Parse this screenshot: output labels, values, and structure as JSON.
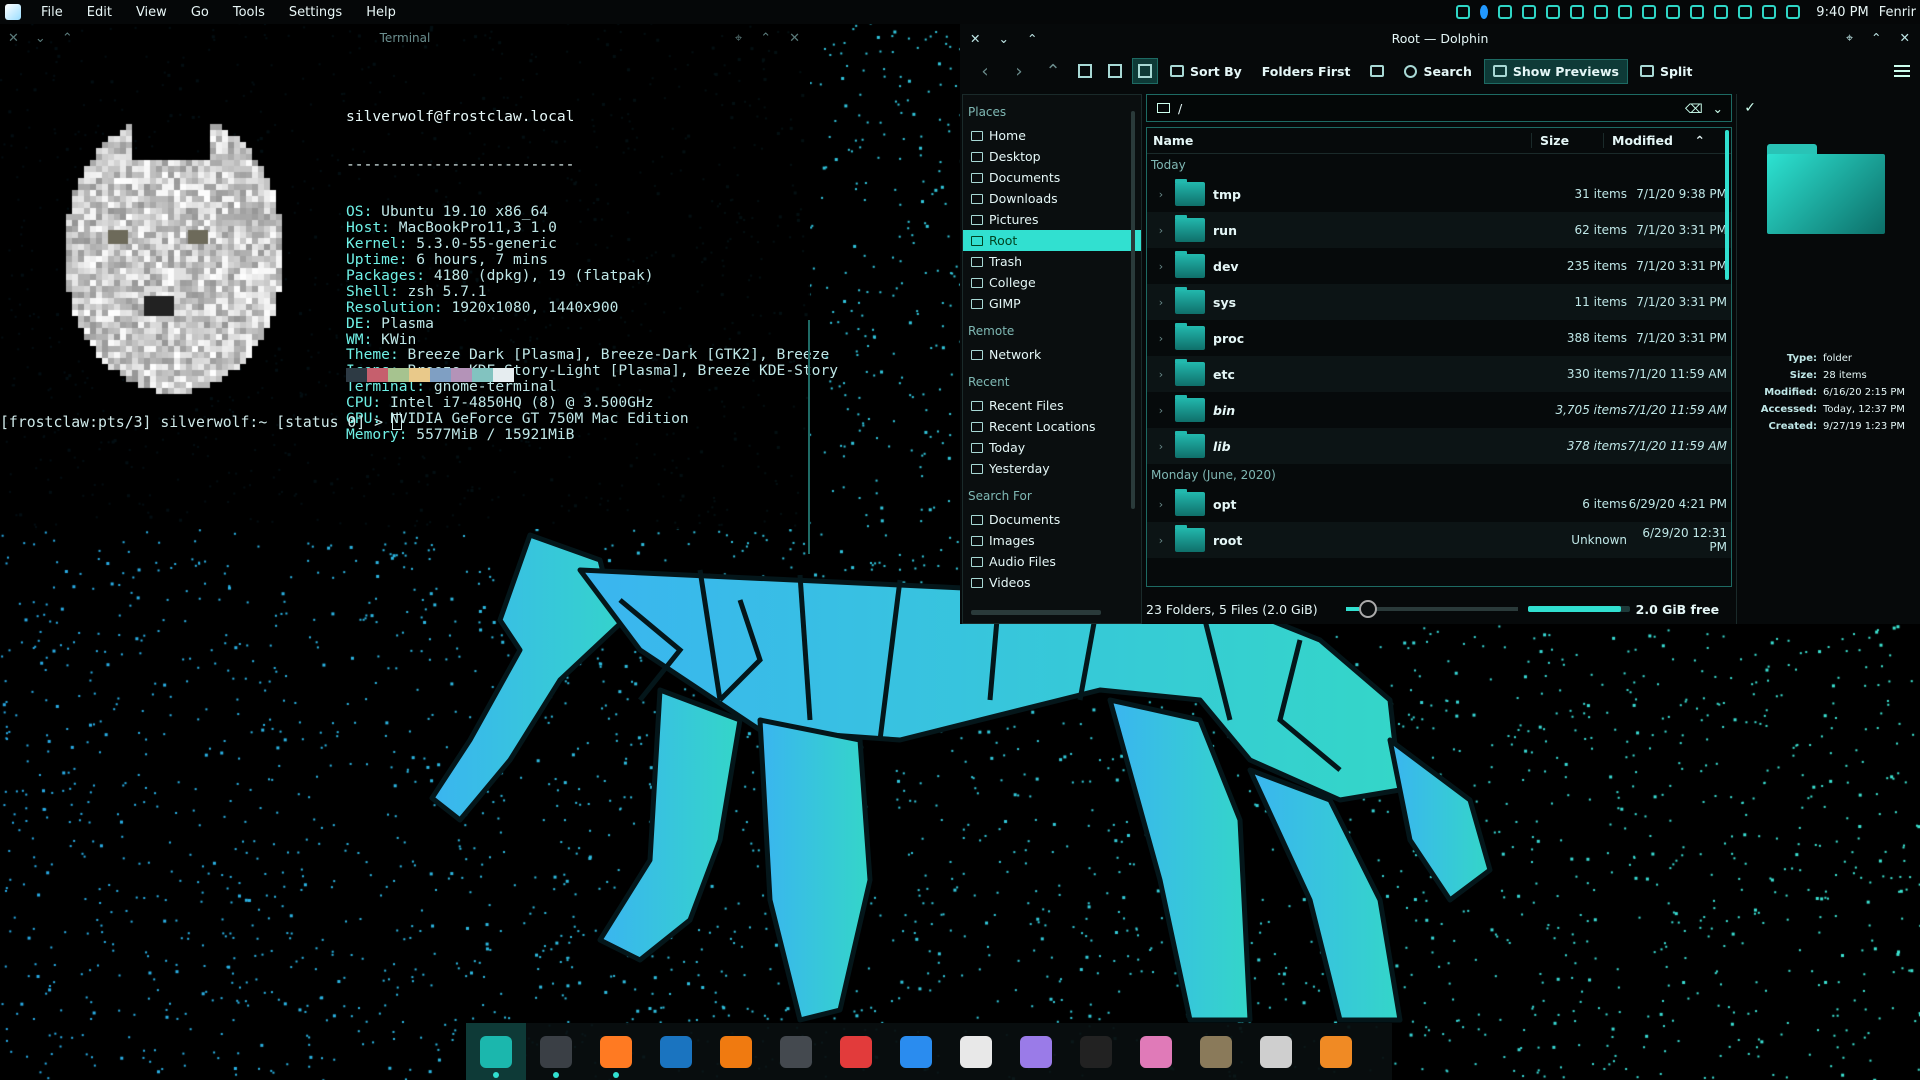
{
  "topbar": {
    "menu": [
      "File",
      "Edit",
      "View",
      "Go",
      "Tools",
      "Settings",
      "Help"
    ],
    "clock": "9:40 PM",
    "user": "Fenrir"
  },
  "terminal": {
    "title": "Terminal",
    "header": "silverwolf@frostclaw.local",
    "separator": "--------------------------",
    "lines": [
      {
        "k": "OS",
        "v": "Ubuntu 19.10 x86_64"
      },
      {
        "k": "Host",
        "v": "MacBookPro11,3 1.0"
      },
      {
        "k": "Kernel",
        "v": "5.3.0-55-generic"
      },
      {
        "k": "Uptime",
        "v": "6 hours, 7 mins"
      },
      {
        "k": "Packages",
        "v": "4180 (dpkg), 19 (flatpak)"
      },
      {
        "k": "Shell",
        "v": "zsh 5.7.1"
      },
      {
        "k": "Resolution",
        "v": "1920x1080, 1440x900"
      },
      {
        "k": "DE",
        "v": "Plasma"
      },
      {
        "k": "WM",
        "v": "KWin"
      },
      {
        "k": "Theme",
        "v": "Breeze Dark [Plasma], Breeze-Dark [GTK2], Breeze"
      },
      {
        "k": "Icons",
        "v": "Breeze KDE-Story-Light [Plasma], Breeze KDE-Story"
      },
      {
        "k": "Terminal",
        "v": "gnome-terminal"
      },
      {
        "k": "CPU",
        "v": "Intel i7-4850HQ (8) @ 3.500GHz"
      },
      {
        "k": "GPU",
        "v": "NVIDIA GeForce GT 750M Mac Edition"
      },
      {
        "k": "Memory",
        "v": "5577MiB / 15921MiB"
      }
    ],
    "swatches": [
      "#2d3a44",
      "#c65f6d",
      "#a6c38f",
      "#e9c98a",
      "#7f9fc3",
      "#b493b8",
      "#82c3c0",
      "#e6edf0"
    ],
    "prompt": "[frostclaw:pts/3] silverwolf:~ [status 0] > "
  },
  "dolphin": {
    "title": "Root — Dolphin",
    "toolbar": {
      "sort_by": "Sort By",
      "folders_first": "Folders First",
      "search": "Search",
      "show_previews": "Show Previews",
      "split": "Split"
    },
    "places": {
      "sections": [
        {
          "title": "Places",
          "items": [
            "Home",
            "Desktop",
            "Documents",
            "Downloads",
            "Pictures",
            "Root",
            "Trash",
            "College",
            "GIMP"
          ]
        },
        {
          "title": "Remote",
          "items": [
            "Network"
          ]
        },
        {
          "title": "Recent",
          "items": [
            "Recent Files",
            "Recent Locations",
            "Today",
            "Yesterday"
          ]
        },
        {
          "title": "Search For",
          "items": [
            "Documents",
            "Images",
            "Audio Files",
            "Videos"
          ]
        }
      ],
      "selected": "Root"
    },
    "location": "/",
    "columns": {
      "name": "Name",
      "size": "Size",
      "modified": "Modified"
    },
    "groups": [
      {
        "label": "Today",
        "rows": [
          {
            "name": "tmp",
            "size": "31 items",
            "modified": "7/1/20 9:38 PM",
            "italic": false
          },
          {
            "name": "run",
            "size": "62 items",
            "modified": "7/1/20 3:31 PM",
            "italic": false
          },
          {
            "name": "dev",
            "size": "235 items",
            "modified": "7/1/20 3:31 PM",
            "italic": false
          },
          {
            "name": "sys",
            "size": "11 items",
            "modified": "7/1/20 3:31 PM",
            "italic": false
          },
          {
            "name": "proc",
            "size": "388 items",
            "modified": "7/1/20 3:31 PM",
            "italic": false
          },
          {
            "name": "etc",
            "size": "330 items",
            "modified": "7/1/20 11:59 AM",
            "italic": false
          },
          {
            "name": "bin",
            "size": "3,705 items",
            "modified": "7/1/20 11:59 AM",
            "italic": true
          },
          {
            "name": "lib",
            "size": "378 items",
            "modified": "7/1/20 11:59 AM",
            "italic": true
          }
        ]
      },
      {
        "label": "Monday (June, 2020)",
        "rows": [
          {
            "name": "opt",
            "size": "6 items",
            "modified": "6/29/20 4:21 PM",
            "italic": false
          },
          {
            "name": "root",
            "size": "Unknown",
            "modified": "6/29/20 12:31 PM",
            "italic": false
          }
        ]
      }
    ],
    "info": [
      {
        "k": "Type:",
        "v": "folder"
      },
      {
        "k": "Size:",
        "v": "28 items"
      },
      {
        "k": "Modified:",
        "v": "6/16/20 2:15 PM"
      },
      {
        "k": "Accessed:",
        "v": "Today, 12:37 PM"
      },
      {
        "k": "Created:",
        "v": "9/27/19 1:23 PM"
      }
    ],
    "status": {
      "summary": "23 Folders, 5 Files (2.0 GiB)",
      "free": "2.0 GiB free",
      "zoom_fraction": 0.08,
      "used_fraction": 0.92
    }
  },
  "dock": {
    "apps": [
      {
        "name": "dolphin-file-manager-icon",
        "color": "#1bb7ad",
        "active": true,
        "running": true
      },
      {
        "name": "terminal-icon",
        "color": "#3a3f45",
        "active": false,
        "running": true
      },
      {
        "name": "firefox-icon",
        "color": "#ff7a22",
        "active": false,
        "running": true
      },
      {
        "name": "steam-icon",
        "color": "#1a74c0",
        "active": false,
        "running": false
      },
      {
        "name": "crossover-icon",
        "color": "#f07a10",
        "active": false,
        "running": false
      },
      {
        "name": "settings-icon",
        "color": "#44494f",
        "active": false,
        "running": false
      },
      {
        "name": "lifebuoy-icon",
        "color": "#e23b3b",
        "active": false,
        "running": false
      },
      {
        "name": "document-icon",
        "color": "#2a8cef",
        "active": false,
        "running": false
      },
      {
        "name": "text-file-icon",
        "color": "#e8e8e8",
        "active": false,
        "running": false
      },
      {
        "name": "discover-icon",
        "color": "#9a7be8",
        "active": false,
        "running": false
      },
      {
        "name": "inkscape-icon",
        "color": "#222",
        "active": false,
        "running": false
      },
      {
        "name": "eye-app-icon",
        "color": "#e07ab8",
        "active": false,
        "running": false
      },
      {
        "name": "gimp-icon",
        "color": "#8a7a5a",
        "active": false,
        "running": false
      },
      {
        "name": "x-app-icon",
        "color": "#cfcfcf",
        "active": false,
        "running": false
      },
      {
        "name": "blender-icon",
        "color": "#f08a24",
        "active": false,
        "running": false
      }
    ]
  }
}
